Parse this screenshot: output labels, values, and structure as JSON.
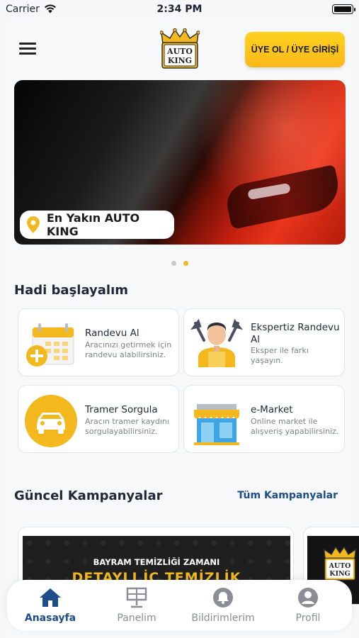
{
  "status": {
    "carrier": "Carrier",
    "time": "2:34 PM"
  },
  "header": {
    "login_label": "ÜYE OL / ÜYE GİRİŞİ",
    "logo_text_line1": "AUTO",
    "logo_text_line2": "KING"
  },
  "banner": {
    "pill_label": "En Yakın AUTO KING",
    "slide_count": 2,
    "active_slide": 2
  },
  "start": {
    "title": "Hadi başlayalım",
    "cards": [
      {
        "title": "Randevu Al",
        "desc": "Aracınızı getirmek için randevu alabilirsiniz.",
        "icon": "calendar-plus-icon"
      },
      {
        "title": "Ekspertiz Randevu Al",
        "desc": "Eksper ile farkı yaşayın.",
        "icon": "mechanic-icon"
      },
      {
        "title": "Tramer Sorgula",
        "desc": "Aracın tramer kaydını sorgulayabilirsiniz.",
        "icon": "car-icon"
      },
      {
        "title": "e-Market",
        "desc": "Online market ile alışveriş yapabilirsiniz.",
        "icon": "store-icon"
      }
    ]
  },
  "campaigns": {
    "title": "Güncel Kampanyalar",
    "all_link": "Tüm Kampanyalar",
    "items": [
      {
        "line1": "BAYRAM TEMİZLİĞİ ZAMANI",
        "line2": "DETAYLI İÇ TEMİZLİK"
      },
      {
        "logo1": "AUTO",
        "logo2": "KING"
      }
    ]
  },
  "nav": {
    "items": [
      {
        "label": "Anasayfa",
        "icon": "home-icon",
        "active": true
      },
      {
        "label": "Panelim",
        "icon": "panel-icon",
        "active": false
      },
      {
        "label": "Bildirimlerim",
        "icon": "bell-icon",
        "active": false
      },
      {
        "label": "Profil",
        "icon": "profile-icon",
        "active": false
      }
    ]
  },
  "colors": {
    "accent_yellow": "#f3b81e",
    "brand_blue": "#1d4d8b",
    "text_dark": "#1f2739"
  }
}
